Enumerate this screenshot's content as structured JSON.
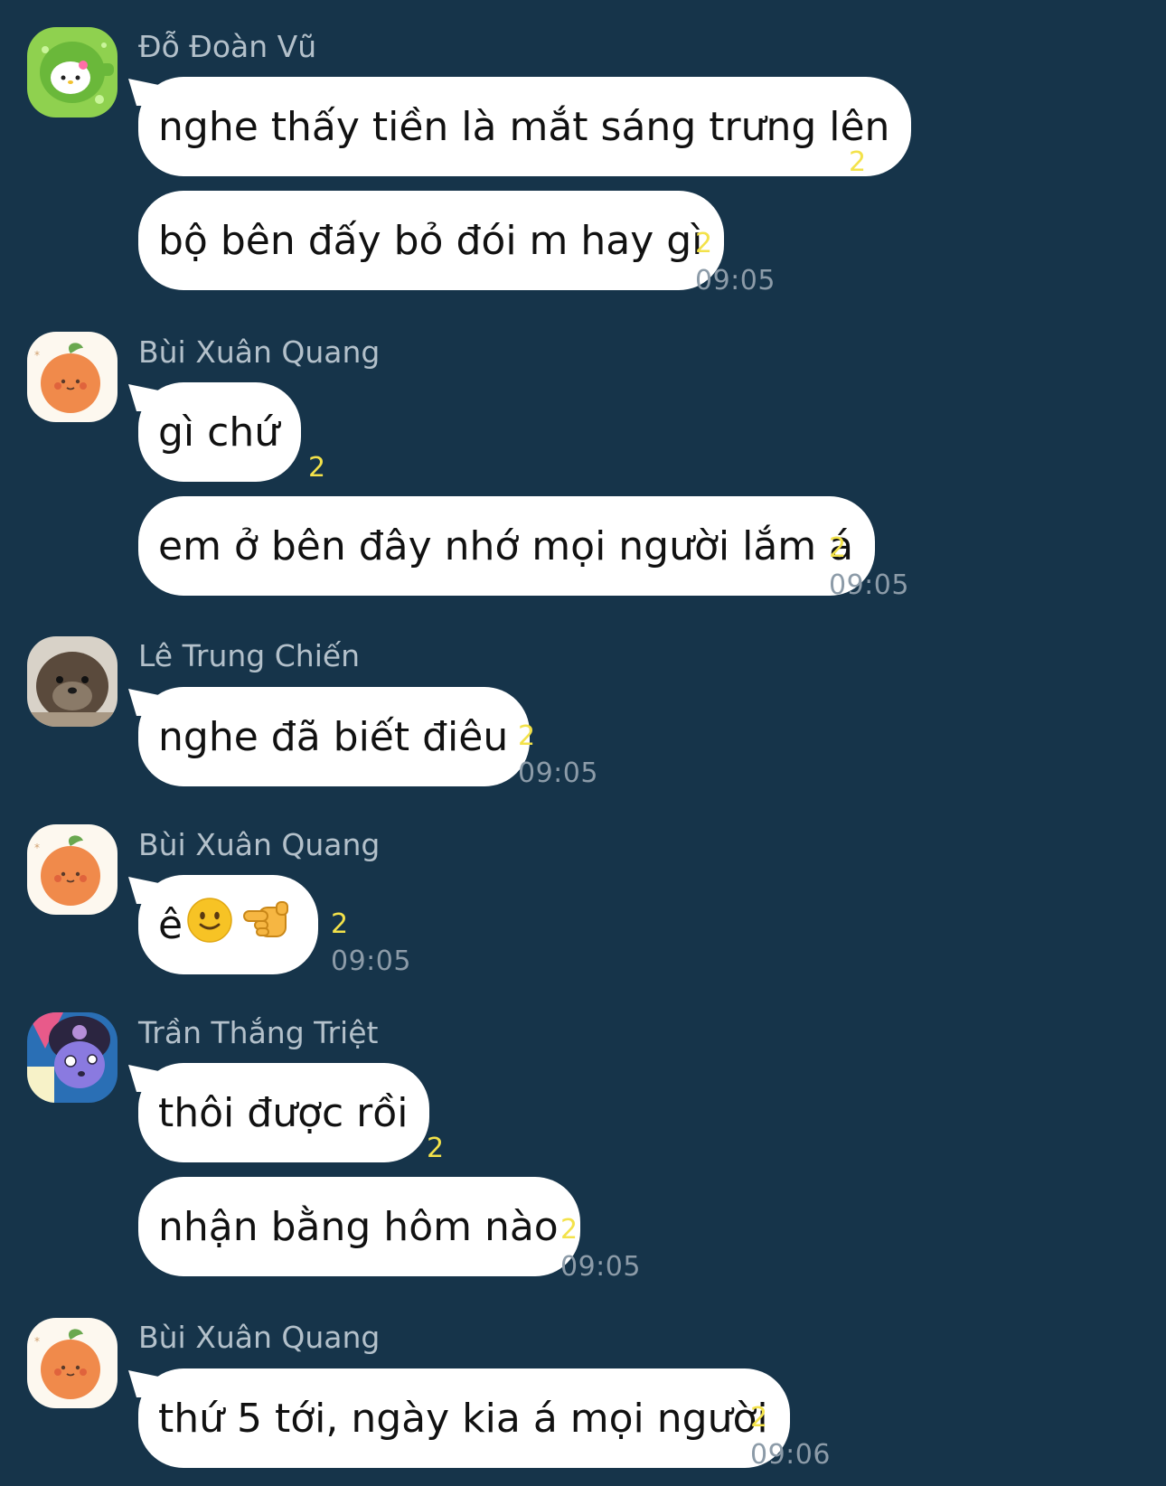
{
  "messages": [
    {
      "sender": "Đỗ Đoàn Vũ",
      "avatar": "hello-kitty-avatar",
      "lines": [
        {
          "text": "nghe thấy tiền là mắt sáng trưng lên",
          "count": "2"
        },
        {
          "text": "bộ bên đấy bỏ đói m hay gì",
          "count": "2",
          "time": "09:05"
        }
      ]
    },
    {
      "sender": "Bùi Xuân Quang",
      "avatar": "orange-avatar",
      "lines": [
        {
          "text": "gì chứ",
          "count": "2"
        },
        {
          "text": "em ở bên đây nhớ mọi người lắm á",
          "count": "2",
          "time": "09:05"
        }
      ]
    },
    {
      "sender": "Lê Trung Chiến",
      "avatar": "otter-avatar",
      "lines": [
        {
          "text": "nghe đã biết điêu",
          "count": "2",
          "time": "09:05"
        }
      ]
    },
    {
      "sender": "Bùi Xuân Quang",
      "avatar": "orange-avatar",
      "lines": [
        {
          "text": "ê",
          "emojis": [
            "slightly-smiling-face-emoji",
            "pointing-hand-emoji"
          ],
          "count": "2",
          "time": "09:05"
        }
      ]
    },
    {
      "sender": "Trần Thắng Triệt",
      "avatar": "kuromi-avatar",
      "lines": [
        {
          "text": "thôi được rồi",
          "count": "2"
        },
        {
          "text": "nhận bằng hôm nào",
          "count": "2",
          "time": "09:05"
        }
      ]
    },
    {
      "sender": "Bùi Xuân Quang",
      "avatar": "orange-avatar",
      "lines": [
        {
          "text": "thứ 5 tới, ngày kia á mọi người",
          "count": "2",
          "time": "09:06"
        }
      ]
    }
  ],
  "colors": {
    "background": "#16344a",
    "bubble": "#ffffff",
    "count": "#f3e24a",
    "time": "#8c9ba8",
    "sender": "#b3c0ca"
  }
}
